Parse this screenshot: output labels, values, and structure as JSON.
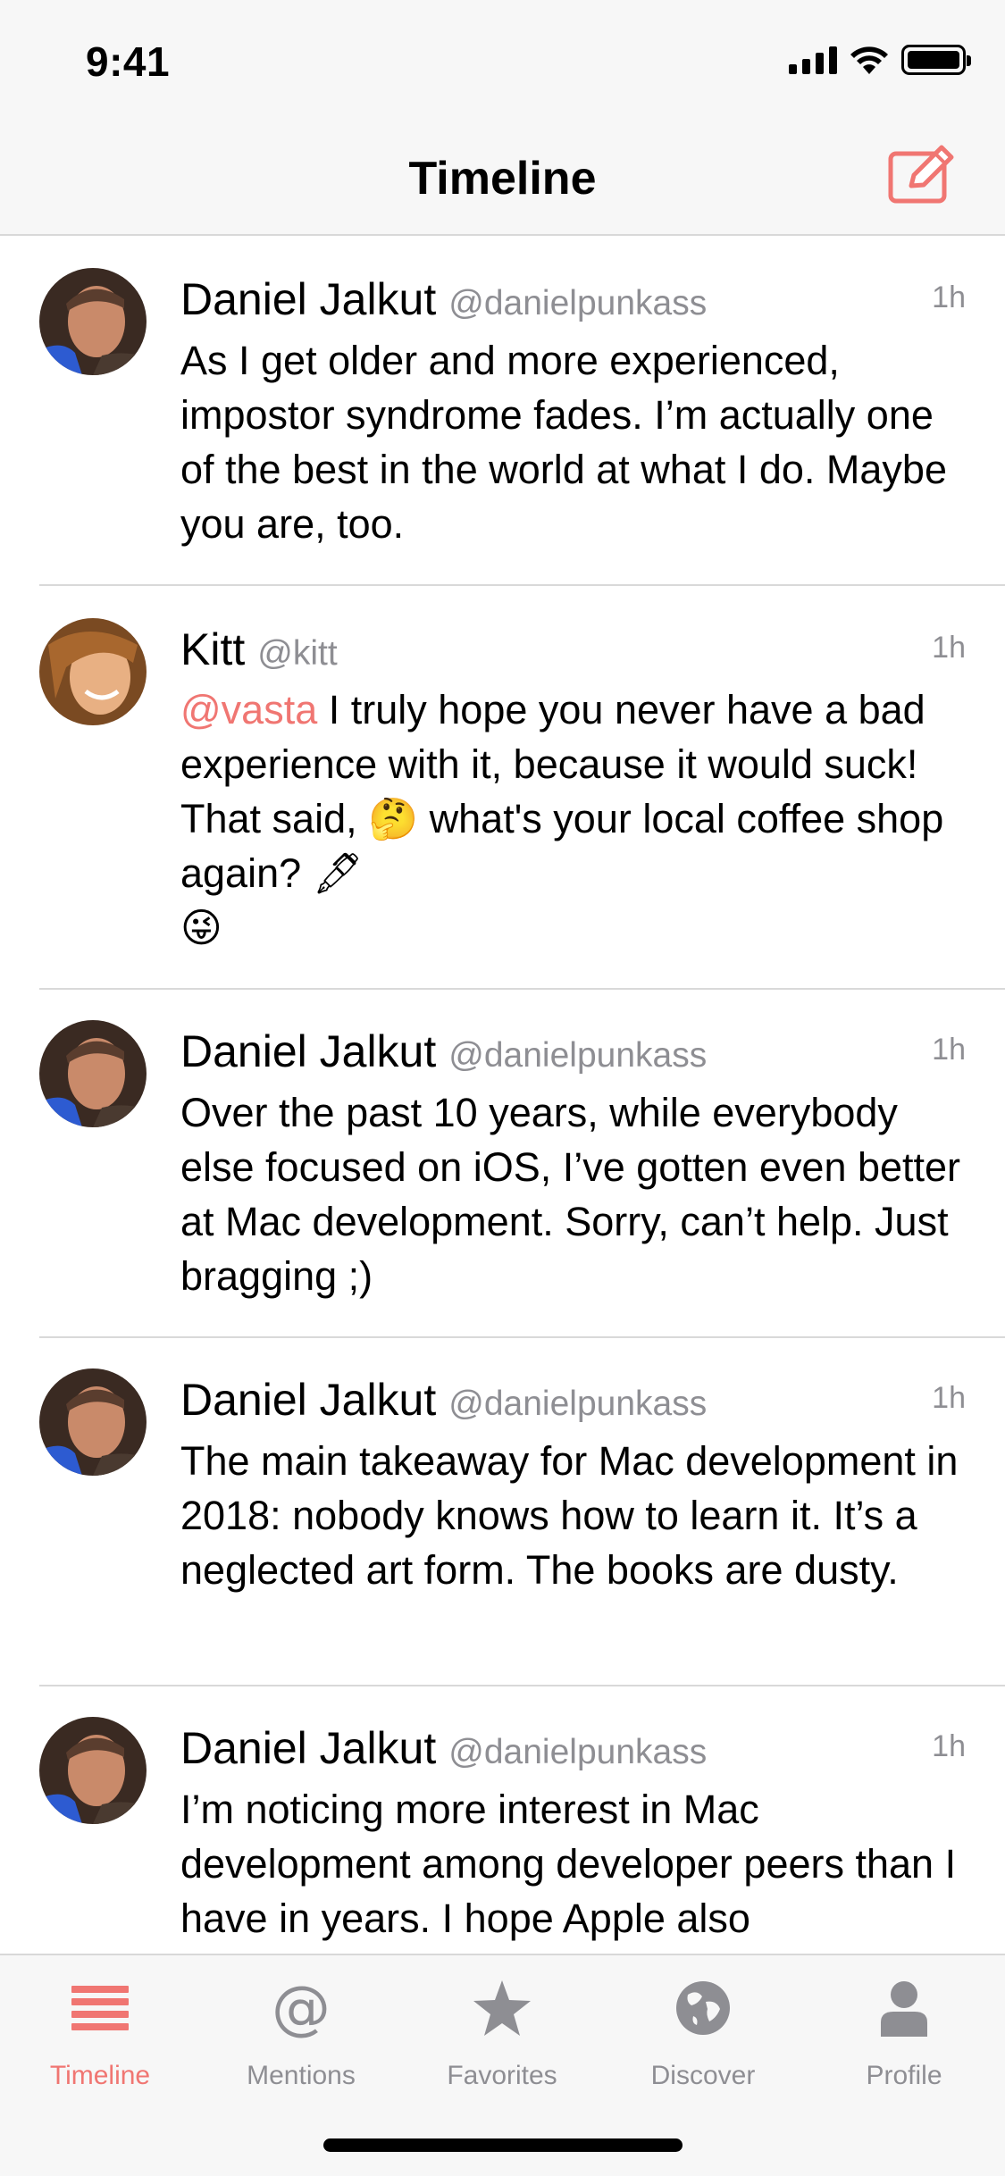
{
  "status": {
    "time": "9:41"
  },
  "nav": {
    "title": "Timeline"
  },
  "posts": [
    {
      "name": "Daniel Jalkut",
      "handle": "@danielpunkass",
      "time": "1h",
      "text": "As I get older and more experienced, impostor syndrome fades. I’m actually one of the best in the world at what I do. Maybe you are, too."
    },
    {
      "name": "Kitt",
      "handle": "@kitt",
      "time": "1h",
      "mention": "@vasta",
      "text_a": " I truly hope you never have a bad experience with it, because it would suck! That said, ",
      "emoji_think": "🤔",
      "text_b": " what's your local coffee shop again? ",
      "emoji_pen": "🖋",
      "emoji_wink": "😜"
    },
    {
      "name": "Daniel Jalkut",
      "handle": "@danielpunkass",
      "time": "1h",
      "text": "Over the past 10 years, while everybody else focused on iOS, I’ve gotten even better at Mac development. Sorry, can’t help. Just bragging ;)"
    },
    {
      "name": "Daniel Jalkut",
      "handle": "@danielpunkass",
      "time": "1h",
      "text": "The main takeaway for Mac development in 2018: nobody knows how to learn it. It’s a neglected art form. The books are dusty."
    },
    {
      "name": "Daniel Jalkut",
      "handle": "@danielpunkass",
      "time": "1h",
      "text": "I’m noticing more interest in Mac development among developer peers than I have in years. I hope Apple also"
    }
  ],
  "tabs": [
    {
      "label": "Timeline",
      "icon": "timeline-icon",
      "active": true
    },
    {
      "label": "Mentions",
      "icon": "at-icon",
      "active": false
    },
    {
      "label": "Favorites",
      "icon": "star-icon",
      "active": false
    },
    {
      "label": "Discover",
      "icon": "globe-icon",
      "active": false
    },
    {
      "label": "Profile",
      "icon": "person-icon",
      "active": false
    }
  ],
  "colors": {
    "accent": "#f07672",
    "muted": "#8e8e93",
    "bar": "#f7f7f7"
  }
}
